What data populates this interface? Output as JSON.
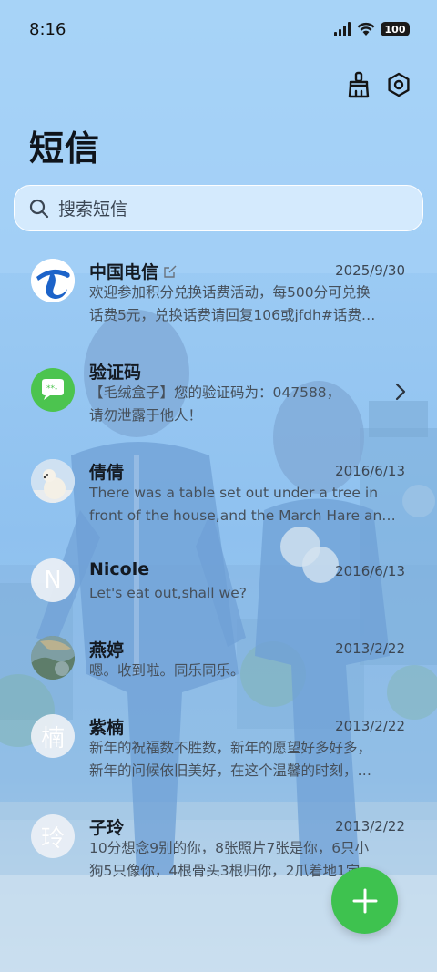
{
  "status_bar": {
    "time": "8:16",
    "battery": "100",
    "icons": [
      "signal-icon",
      "wifi-icon",
      "battery-icon"
    ]
  },
  "header": {
    "title": "短信",
    "actions": [
      "broom-icon",
      "settings-icon"
    ]
  },
  "search": {
    "placeholder": "搜索短信"
  },
  "messages": [
    {
      "sender": "中国电信",
      "date": "2025/9/30",
      "line1": "欢迎参加积分兑换话费活动，每500分可兑换",
      "line2": "话费5元，兑换话费请回复106或jfdh#话费…",
      "avatar": "china-telecom-logo",
      "badge": "edit-icon"
    },
    {
      "sender": "验证码",
      "date": "",
      "line1": "【毛绒盒子】您的验证码为：047588，",
      "line2": "请勿泄露于他人！",
      "avatar": "message-bubble-icon",
      "trailing": "chevron-right-icon"
    },
    {
      "sender": "倩倩",
      "date": "2016/6/13",
      "line1": "There was a table set out under a tree in",
      "line2": "front of the house,and the March Hare an…",
      "avatar": "polar-bear-photo"
    },
    {
      "sender": "Nicole",
      "date": "2016/6/13",
      "line1": "Let's eat out,shall we?",
      "line2": "",
      "avatar_letter": "N"
    },
    {
      "sender": "燕婷",
      "date": "2013/2/22",
      "line1": "嗯。收到啦。同乐同乐。",
      "line2": "",
      "avatar": "landscape-photo"
    },
    {
      "sender": "紫楠",
      "date": "2013/2/22",
      "line1": "新年的祝福数不胜数，新年的愿望好多好多，",
      "line2": "新年的问候依旧美好，在这个温馨的时刻，…",
      "avatar_letter": "楠"
    },
    {
      "sender": "子玲",
      "date": "2013/2/22",
      "line1": "10分想念9别的你，8张照片7张是你，6只小",
      "line2": "狗5只像你，4根骨头3根归你，2爪着地1定…",
      "avatar_letter": "玲"
    }
  ],
  "fab": {
    "icon": "plus-icon"
  },
  "colors": {
    "accent_green": "#3ec24f",
    "telecom_blue": "#1c63c9"
  }
}
